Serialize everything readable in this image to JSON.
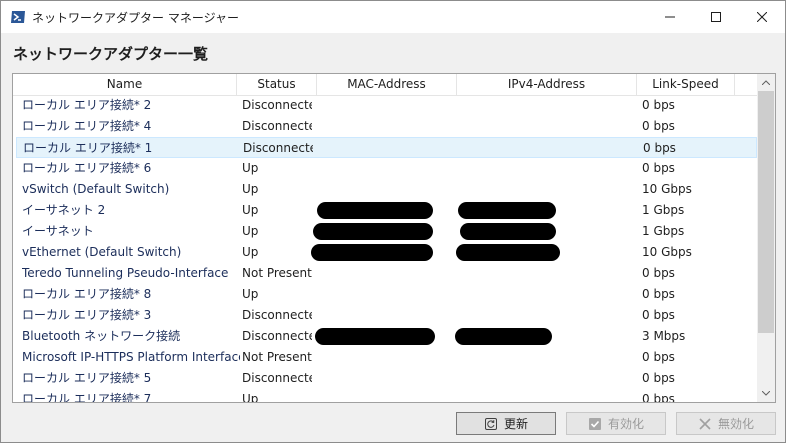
{
  "window": {
    "title": "ネットワークアダプター マネージャー"
  },
  "heading": "ネットワークアダプター一覧",
  "columns": [
    "Name",
    "Status",
    "MAC-Address",
    "IPv4-Address",
    "Link-Speed"
  ],
  "rows": [
    {
      "name": "ローカル エリア接続* 2",
      "status": "Disconnected",
      "speed": "0 bps"
    },
    {
      "name": "ローカル エリア接続* 4",
      "status": "Disconnected",
      "speed": "0 bps"
    },
    {
      "name": "ローカル エリア接続* 1",
      "status": "Disconnected",
      "speed": "0 bps"
    },
    {
      "name": "ローカル エリア接続* 6",
      "status": "Up",
      "speed": "0 bps"
    },
    {
      "name": "vSwitch (Default Switch)",
      "status": "Up",
      "speed": "10 Gbps"
    },
    {
      "name": "イーサネット 2",
      "status": "Up",
      "speed": "1 Gbps"
    },
    {
      "name": "イーサネット",
      "status": "Up",
      "speed": "1 Gbps"
    },
    {
      "name": "vEthernet (Default Switch)",
      "status": "Up",
      "speed": "10 Gbps"
    },
    {
      "name": "Teredo Tunneling Pseudo-Interface",
      "status": "Not Present",
      "speed": "0 bps"
    },
    {
      "name": "ローカル エリア接続* 8",
      "status": "Up",
      "speed": "0 bps"
    },
    {
      "name": "ローカル エリア接続* 3",
      "status": "Disconnected",
      "speed": "0 bps"
    },
    {
      "name": "Bluetooth ネットワーク接続",
      "status": "Disconnected",
      "speed": "3 Mbps"
    },
    {
      "name": "Microsoft IP-HTTPS Platform Interface",
      "status": "Not Present",
      "speed": "0 bps"
    },
    {
      "name": "ローカル エリア接続* 5",
      "status": "Disconnected",
      "speed": "0 bps"
    },
    {
      "name": "ローカル エリア接続* 7",
      "status": "Up",
      "speed": "0 bps"
    }
  ],
  "buttons": {
    "refresh": "更新",
    "enable": "有効化",
    "disable": "無効化"
  }
}
